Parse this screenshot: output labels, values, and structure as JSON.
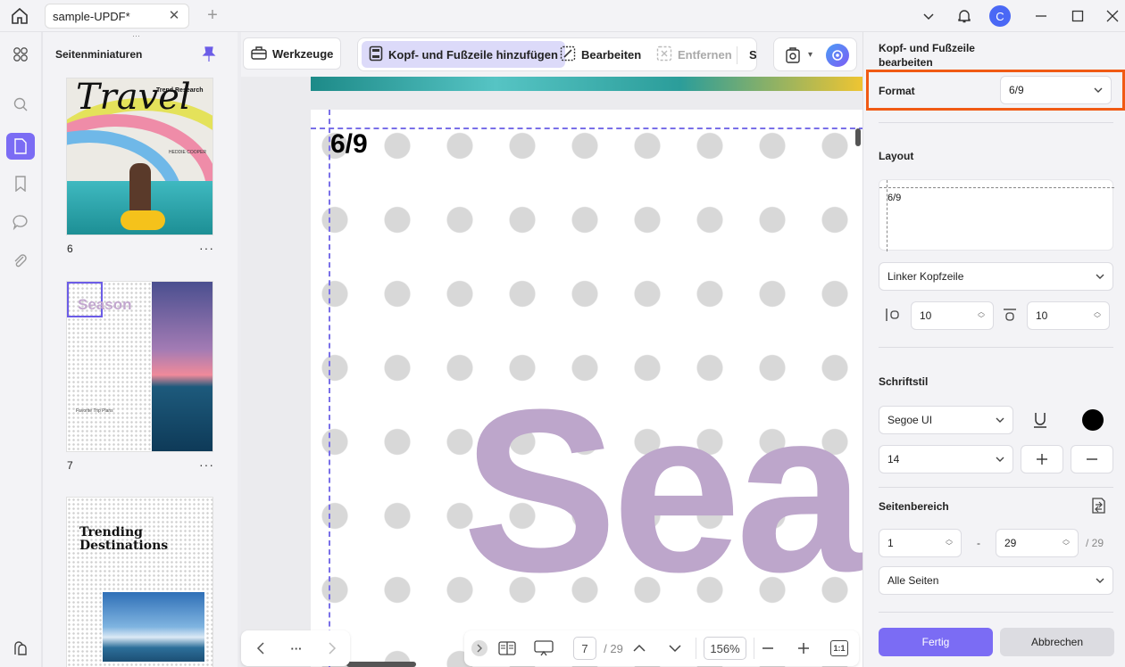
{
  "app": {
    "tab_title": "sample-UPDF*"
  },
  "thumbs": {
    "title": "Seitenminiaturen",
    "pages": [
      {
        "num": "6",
        "title": "Travel",
        "subtitle": "Trend Research",
        "author": "HEDDIE COOPER"
      },
      {
        "num": "7",
        "title": "Season",
        "caption": "Favorite Trip Plans"
      },
      {
        "num": "",
        "title": "Trending Destinations"
      }
    ]
  },
  "toolbar": {
    "tools": "Werkzeuge",
    "header_footer": "Kopf- und Fußzeile hinzufügen",
    "edit": "Bearbeiten",
    "remove": "Entfernen",
    "cut_letter": "S"
  },
  "canvas": {
    "header_text": "6/9",
    "big_text": "Sea"
  },
  "bottom": {
    "more": "···",
    "page_current": "7",
    "page_total": "/ 29",
    "zoom": "156%",
    "fit": "1:1"
  },
  "panel": {
    "title": "Kopf- und Fußzeile bearbeiten",
    "format_label": "Format",
    "format_value": "6/9",
    "layout_label": "Layout",
    "layout_preview": "6/9",
    "position_value": "Linker Kopfzeile",
    "margin_left": "10",
    "margin_top": "10",
    "font_label": "Schriftstil",
    "font_value": "Segoe UI",
    "size_value": "14",
    "range_label": "Seitenbereich",
    "range_from": "1",
    "range_dash": "-",
    "range_to": "29",
    "range_total": "/ 29",
    "pages_value": "Alle Seiten",
    "done": "Fertig",
    "cancel": "Abbrechen"
  },
  "colors": {
    "accent": "#7b6cf4",
    "highlight": "#f05a14",
    "big_text": "#bda6cb",
    "font_color": "#000000"
  }
}
